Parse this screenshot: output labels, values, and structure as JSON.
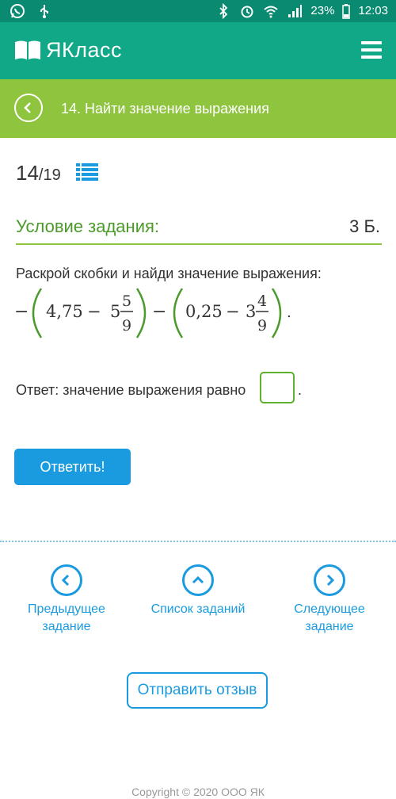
{
  "status_bar": {
    "battery": "23%",
    "time": "12:03"
  },
  "header": {
    "logo_text": "ЯКласс"
  },
  "task_bar": {
    "title": "14. Найти значение выражения"
  },
  "progress": {
    "current": "14",
    "total": "/19"
  },
  "condition": {
    "heading": "Условие задания:",
    "points": "3 Б.",
    "text": "Раскрой скобки и найди значение выражения:",
    "formula": {
      "a": "4,75",
      "b_whole": "5",
      "b_num": "5",
      "b_den": "9",
      "c": "0,25",
      "d_whole": "3",
      "d_num": "4",
      "d_den": "9"
    },
    "answer_label": "Ответ: значение выражения равно",
    "answer_value": "",
    "answer_suffix": "."
  },
  "actions": {
    "submit_label": "Ответить!"
  },
  "nav": {
    "prev_label": "Предыдущее задание",
    "list_label": "Список заданий",
    "next_label": "Следующее задание"
  },
  "feedback": {
    "label": "Отправить отзыв"
  },
  "footer": {
    "copyright": "Copyright © 2020 ООО ЯК"
  }
}
